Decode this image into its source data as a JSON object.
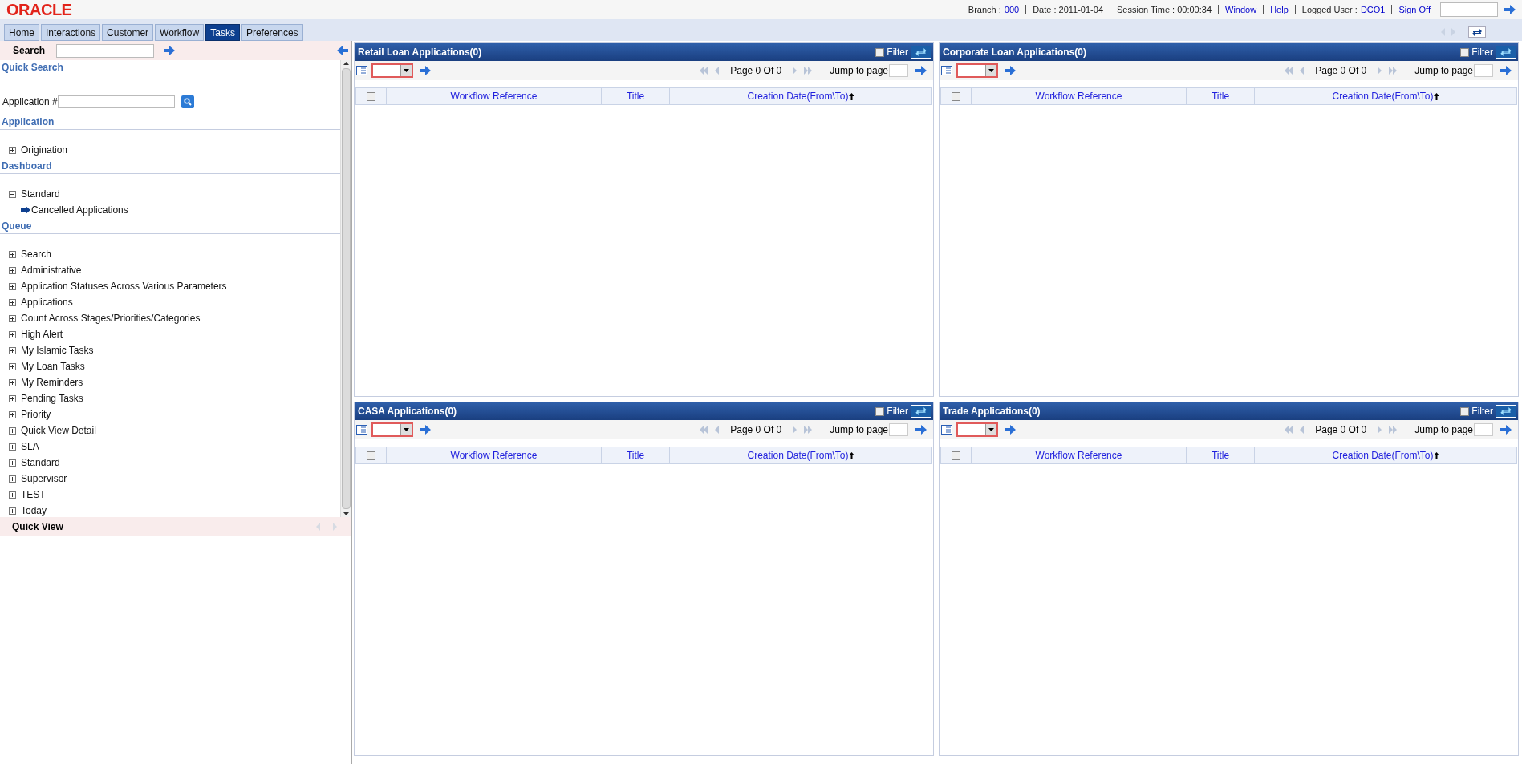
{
  "header": {
    "logo": "ORACLE",
    "branch_label": "Branch :",
    "branch": "000",
    "date_label": "Date :",
    "date": "2011-01-04",
    "session_label": "Session Time :",
    "session_time": "00:00:34",
    "links": [
      "Window",
      "Help"
    ],
    "user_label": "Logged User :",
    "user": "DCO1",
    "sign_off": "Sign Off"
  },
  "tabs": [
    {
      "label": "Home",
      "selected": false
    },
    {
      "label": "Interactions",
      "selected": false
    },
    {
      "label": "Customer",
      "selected": false
    },
    {
      "label": "Workflow",
      "selected": false
    },
    {
      "label": "Tasks",
      "selected": true
    },
    {
      "label": "Preferences",
      "selected": false
    }
  ],
  "sidebar": {
    "search_label": "Search",
    "quick_search": "Quick Search",
    "application_label": "Application #",
    "sections": [
      {
        "title": "Application",
        "items": [
          {
            "label": "Origination",
            "expanded": false
          }
        ]
      },
      {
        "title": "Dashboard",
        "items": [
          {
            "label": "Standard",
            "expanded": true,
            "children": [
              {
                "label": "Cancelled Applications"
              }
            ]
          }
        ]
      },
      {
        "title": "Queue",
        "items": [
          {
            "label": "Search",
            "expanded": false
          },
          {
            "label": "Administrative",
            "expanded": false
          },
          {
            "label": "Application Statuses Across Various Parameters",
            "expanded": false
          },
          {
            "label": "Applications",
            "expanded": false
          },
          {
            "label": "Count Across Stages/Priorities/Categories",
            "expanded": false
          },
          {
            "label": "High Alert",
            "expanded": false
          },
          {
            "label": "My Islamic Tasks",
            "expanded": false
          },
          {
            "label": "My Loan Tasks",
            "expanded": false
          },
          {
            "label": "My Reminders",
            "expanded": false
          },
          {
            "label": "Pending Tasks",
            "expanded": false
          },
          {
            "label": "Priority",
            "expanded": false
          },
          {
            "label": "Quick View Detail",
            "expanded": false
          },
          {
            "label": "SLA",
            "expanded": false
          },
          {
            "label": "Standard",
            "expanded": false
          },
          {
            "label": "Supervisor",
            "expanded": false
          },
          {
            "label": "TEST",
            "expanded": false
          },
          {
            "label": "Today",
            "expanded": false
          }
        ]
      }
    ],
    "quick_view": "Quick View"
  },
  "panels": [
    {
      "title": "Retail Loan Applications(0)",
      "filter_label": "Filter",
      "filter_checked": false,
      "all_checked": false,
      "page_info": "Page 0 Of 0",
      "jump_label": "Jump to page",
      "columns": [
        "Workflow Reference",
        "Title",
        "Creation Date(From\\To)"
      ]
    },
    {
      "title": "Corporate Loan Applications(0)",
      "filter_label": "Filter",
      "filter_checked": false,
      "all_checked": false,
      "page_info": "Page 0 Of 0",
      "jump_label": "Jump to page",
      "columns": [
        "Workflow Reference",
        "Title",
        "Creation Date(From\\To)"
      ]
    },
    {
      "title": "CASA Applications(0)",
      "filter_label": "Filter",
      "filter_checked": false,
      "all_checked": false,
      "page_info": "Page 0 Of 0",
      "jump_label": "Jump to page",
      "columns": [
        "Workflow Reference",
        "Title",
        "Creation Date(From\\To)"
      ]
    },
    {
      "title": "Trade Applications(0)",
      "filter_label": "Filter",
      "filter_checked": false,
      "all_checked": false,
      "page_info": "Page 0 Of 0",
      "jump_label": "Jump to page",
      "columns": [
        "Workflow Reference",
        "Title",
        "Creation Date(From\\To)"
      ]
    }
  ]
}
